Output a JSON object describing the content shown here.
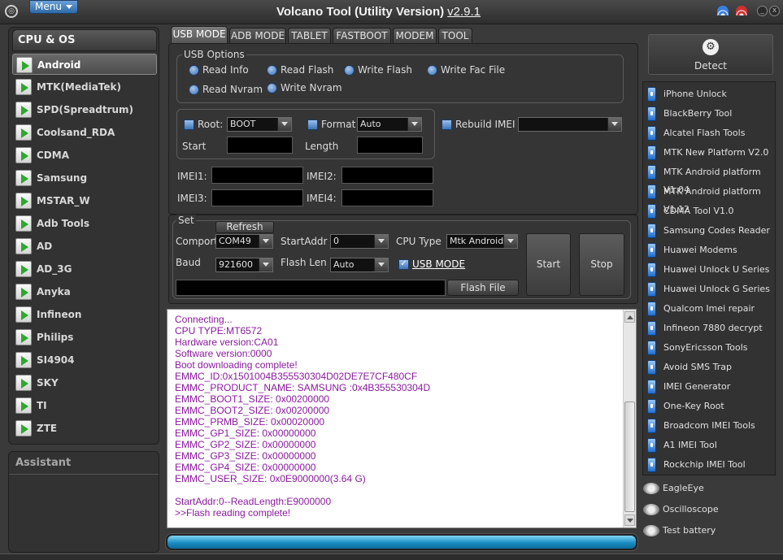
{
  "window": {
    "title": "Volcano Tool (Utility Version)",
    "version": "v2.9.1",
    "menu_label": "Menu",
    "min_glyph": "_",
    "close_glyph": "x"
  },
  "left": {
    "header": "CPU & OS",
    "items": [
      "Android",
      "MTK(MediaTek)",
      "SPD(Spreadtrum)",
      "Coolsand_RDA",
      "CDMA",
      "Samsung",
      "MSTAR_W",
      "Adb Tools",
      "AD",
      "AD_3G",
      "Anyka",
      "Infineon",
      "Philips",
      "SI4904",
      "SKY",
      "TI",
      "ZTE"
    ],
    "selected": "Android",
    "assistant_label": "Assistant"
  },
  "tabs": [
    "USB MODE",
    "ADB MODE",
    "TABLET",
    "FASTBOOT",
    "MODEM",
    "TOOL"
  ],
  "active_tab": "USB MODE",
  "usb_options": {
    "legend": "USB Options",
    "radios": [
      "Read Info",
      "Read Flash",
      "Write Flash",
      "Write Fac File",
      "Read Nvram",
      "Write Nvram"
    ]
  },
  "root_group": {
    "root_label": "Root:",
    "root_value": "BOOT",
    "format_label": "Format",
    "format_value": "Auto",
    "start_label": "Start",
    "length_label": "Length",
    "rebuild_label": "Rebuild IMEI"
  },
  "imei": {
    "imei1": "IMEI1:",
    "imei2": "IMEI2:",
    "imei3": "IMEI3:",
    "imei4": "IMEI4:"
  },
  "set": {
    "legend": "Set",
    "refresh": "Refresh",
    "comport_label": "Comport",
    "comport_value": "COM49",
    "startaddr_label": "StartAddr",
    "startaddr_value": "0",
    "cputype_label": "CPU Type",
    "cputype_value": "Mtk Android",
    "baud_label": "Baud",
    "baud_value": "921600",
    "flashlen_label": "Flash Len",
    "flashlen_value": "Auto",
    "usbmode_label": "USB MODE",
    "start_button": "Start",
    "stop_button": "Stop",
    "flashfile_button": "Flash File"
  },
  "log_lines": [
    "Connecting...",
    "CPU TYPE:MT6572",
    "Hardware version:CA01",
    "Software version:0000",
    "Boot downloading complete!",
    "EMMC_ID:0x1501004B355530304D02DE7E7CF480CF",
    "EMMC_PRODUCT_NAME: SAMSUNG :0x4B355530304D",
    "EMMC_BOOT1_SIZE: 0x00200000",
    "EMMC_BOOT2_SIZE: 0x00200000",
    "EMMC_PRMB_SIZE: 0x00020000",
    "EMMC_GP1_SIZE: 0x00000000",
    "EMMC_GP2_SIZE: 0x00000000",
    "EMMC_GP3_SIZE: 0x00000000",
    "EMMC_GP4_SIZE: 0x00000000",
    "EMMC_USER_SIZE: 0x0E9000000(3.64 G)",
    "",
    "StartAddr:0--ReadLength:E9000000",
    ">>Flash reading complete!"
  ],
  "progress_percent": 100,
  "right": {
    "detect_label": "Detect",
    "items": [
      "iPhone Unlock",
      "BlackBerry Tool",
      "Alcatel Flash Tools",
      "MTK New Platform V2.0",
      "MTK Android platform V1.04",
      "MTK Android platform V1.12",
      "CDMA Tool  V1.0",
      "Samsung Codes Reader",
      "Huawei Modems",
      "Huawei Unlock U Series",
      "Huawei Unlock G Series",
      "Qualcom Imei repair",
      "Infineon 7880 decrypt",
      "SonyEricsson Tools",
      "Avoid SMS Trap",
      "IMEI Generator",
      "One-Key Root",
      "Broadcom IMEI Tools",
      "A1 IMEI Tool",
      "Rockchip IMEI Tool"
    ],
    "tools": [
      "EagleEye",
      "Oscilloscope",
      "Test battery"
    ]
  }
}
